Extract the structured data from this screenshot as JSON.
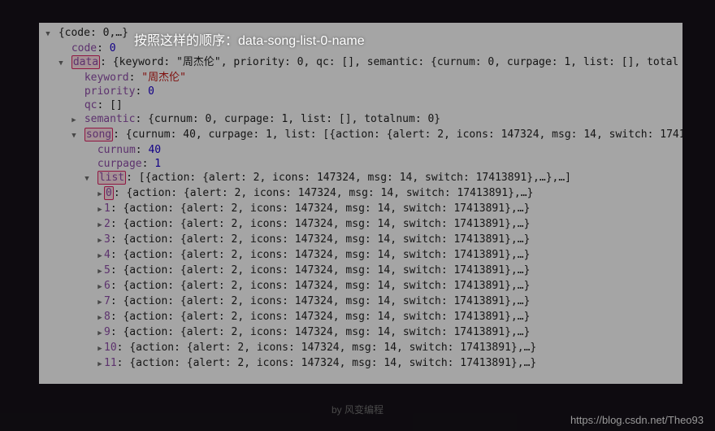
{
  "callout": "按照这样的顺序：data-song-list-0-name",
  "footer": "by 风变编程",
  "watermark": "https://blog.csdn.net/Theo93",
  "root_preview": "{code: 0,…}",
  "code": {
    "key": "code",
    "value": "0"
  },
  "data": {
    "key": "data",
    "preview": "{keyword: \"周杰伦\", priority: 0, qc: [], semantic: {curnum: 0, curpage: 1, list: [], total",
    "keyword": {
      "key": "keyword",
      "value": "\"周杰伦\""
    },
    "priority": {
      "key": "priority",
      "value": "0"
    },
    "qc": {
      "key": "qc",
      "value": "[]"
    },
    "semantic": {
      "key": "semantic",
      "preview": "{curnum: 0, curpage: 1, list: [], totalnum: 0}"
    },
    "song": {
      "key": "song",
      "preview": "{curnum: 40, curpage: 1, list: [{action: {alert: 2, icons: 147324, msg: 14, switch: 1741",
      "curnum": {
        "key": "curnum",
        "value": "40"
      },
      "curpage": {
        "key": "curpage",
        "value": "1"
      },
      "list": {
        "key": "list",
        "preview": "[{action: {alert: 2, icons: 147324, msg: 14, switch: 17413891},…},…]",
        "items": [
          {
            "idx": "0",
            "preview": "{action: {alert: 2, icons: 147324, msg: 14, switch: 17413891},…}"
          },
          {
            "idx": "1",
            "preview": "{action: {alert: 2, icons: 147324, msg: 14, switch: 17413891},…}"
          },
          {
            "idx": "2",
            "preview": "{action: {alert: 2, icons: 147324, msg: 14, switch: 17413891},…}"
          },
          {
            "idx": "3",
            "preview": "{action: {alert: 2, icons: 147324, msg: 14, switch: 17413891},…}"
          },
          {
            "idx": "4",
            "preview": "{action: {alert: 2, icons: 147324, msg: 14, switch: 17413891},…}"
          },
          {
            "idx": "5",
            "preview": "{action: {alert: 2, icons: 147324, msg: 14, switch: 17413891},…}"
          },
          {
            "idx": "6",
            "preview": "{action: {alert: 2, icons: 147324, msg: 14, switch: 17413891},…}"
          },
          {
            "idx": "7",
            "preview": "{action: {alert: 2, icons: 147324, msg: 14, switch: 17413891},…}"
          },
          {
            "idx": "8",
            "preview": "{action: {alert: 2, icons: 147324, msg: 14, switch: 17413891},…}"
          },
          {
            "idx": "9",
            "preview": "{action: {alert: 2, icons: 147324, msg: 14, switch: 17413891},…}"
          },
          {
            "idx": "10",
            "preview": "{action: {alert: 2, icons: 147324, msg: 14, switch: 17413891},…}"
          },
          {
            "idx": "11",
            "preview": "{action: {alert: 2, icons: 147324, msg: 14, switch: 17413891},…}"
          }
        ]
      }
    }
  }
}
